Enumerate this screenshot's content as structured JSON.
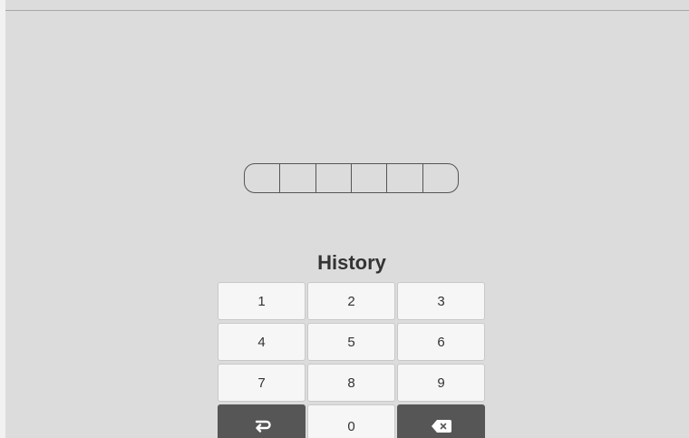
{
  "title": "History",
  "pin": {
    "length": 6
  },
  "keypad": {
    "keys": [
      "1",
      "2",
      "3",
      "4",
      "5",
      "6",
      "7",
      "8",
      "9"
    ],
    "zero": "0",
    "enter_icon": "enter-return-icon",
    "backspace_icon": "backspace-icon"
  }
}
